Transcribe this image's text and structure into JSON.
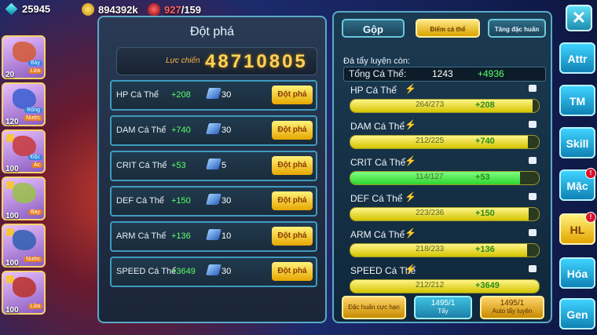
{
  "topbar": {
    "gems": "25945",
    "gold": "894392k",
    "stamina": "927",
    "stamina_max": "/159"
  },
  "pets": [
    {
      "level": "20",
      "tag1": "Bay",
      "tag2": "Lửa",
      "color": "#d45a35"
    },
    {
      "level": "120",
      "tag1": "Rồng",
      "tag2": "Nước",
      "color": "#3a5fd0"
    },
    {
      "level": "100",
      "tag1": "Độc",
      "tag2": "Ác",
      "color": "#c83a3a"
    },
    {
      "level": "100",
      "tag1": "",
      "tag2": "Bay",
      "color": "#9ac14a"
    },
    {
      "level": "100",
      "tag1": "",
      "tag2": "Nước",
      "color": "#2e5fb0"
    },
    {
      "level": "100",
      "tag1": "",
      "tag2": "Lửa",
      "color": "#b83028"
    }
  ],
  "breakthrough": {
    "title": "Đột phá",
    "power_label": "Lực chiến",
    "power_value": "48710805",
    "rows": [
      {
        "name": "HP Cá Thể",
        "bonus": "+208",
        "cost": "30",
        "button": "Đột phá"
      },
      {
        "name": "DAM Cá Thể",
        "bonus": "+740",
        "cost": "30",
        "button": "Đột phá"
      },
      {
        "name": "CRIT Cá Thể",
        "bonus": "+53",
        "cost": "5",
        "button": "Đột phá"
      },
      {
        "name": "DEF Cá Thể",
        "bonus": "+150",
        "cost": "30",
        "button": "Đột phá"
      },
      {
        "name": "ARM Cá Thể",
        "bonus": "+136",
        "cost": "10",
        "button": "Đột phá"
      },
      {
        "name": "SPEED Cá Thể",
        "bonus": "+3649",
        "cost": "30",
        "button": "Đột phá"
      }
    ]
  },
  "training": {
    "tabs": {
      "gop": "Gộp",
      "diem": "Điểm cá thể",
      "tang": "Tăng đặc huấn"
    },
    "remaining_label": "Đá tẩy luyện còn:",
    "total_label": "Tổng Cá Thể:",
    "total_value": "1243",
    "total_bonus": "+4936",
    "stats": [
      {
        "name": "HP Cá Thể",
        "progress": "264/273",
        "bonus": "+208",
        "fill": 0.967
      },
      {
        "name": "DAM Cá Thể",
        "progress": "212/225",
        "bonus": "+740",
        "fill": 0.942
      },
      {
        "name": "CRIT Cá Thể",
        "progress": "114/127",
        "bonus": "+53",
        "fill": 0.898
      },
      {
        "name": "DEF Cá Thể",
        "progress": "223/236",
        "bonus": "+150",
        "fill": 0.945
      },
      {
        "name": "ARM Cá Thể",
        "progress": "218/233",
        "bonus": "+136",
        "fill": 0.936
      },
      {
        "name": "SPEED Cá Thể",
        "progress": "212/212",
        "bonus": "+3649",
        "fill": 1.0
      }
    ],
    "buttons": {
      "dac": "Đặc huấn cực hạn",
      "tay_count": "1495/1",
      "tay": "Tẩy",
      "auto_count": "1495/1",
      "auto": "Auto tẩy luyện"
    }
  },
  "sidebar": {
    "close": "✕",
    "items": [
      {
        "label": "Attr",
        "style": "blue",
        "alert": false
      },
      {
        "label": "TM",
        "style": "blue",
        "alert": false
      },
      {
        "label": "Skill",
        "style": "blue",
        "alert": false
      },
      {
        "label": "Mặc",
        "style": "blue",
        "alert": true
      },
      {
        "label": "HL",
        "style": "gold",
        "alert": true
      },
      {
        "label": "Hóa",
        "style": "blue",
        "alert": false
      },
      {
        "label": "Gen",
        "style": "blue",
        "alert": false
      }
    ],
    "alert_mark": "!"
  }
}
